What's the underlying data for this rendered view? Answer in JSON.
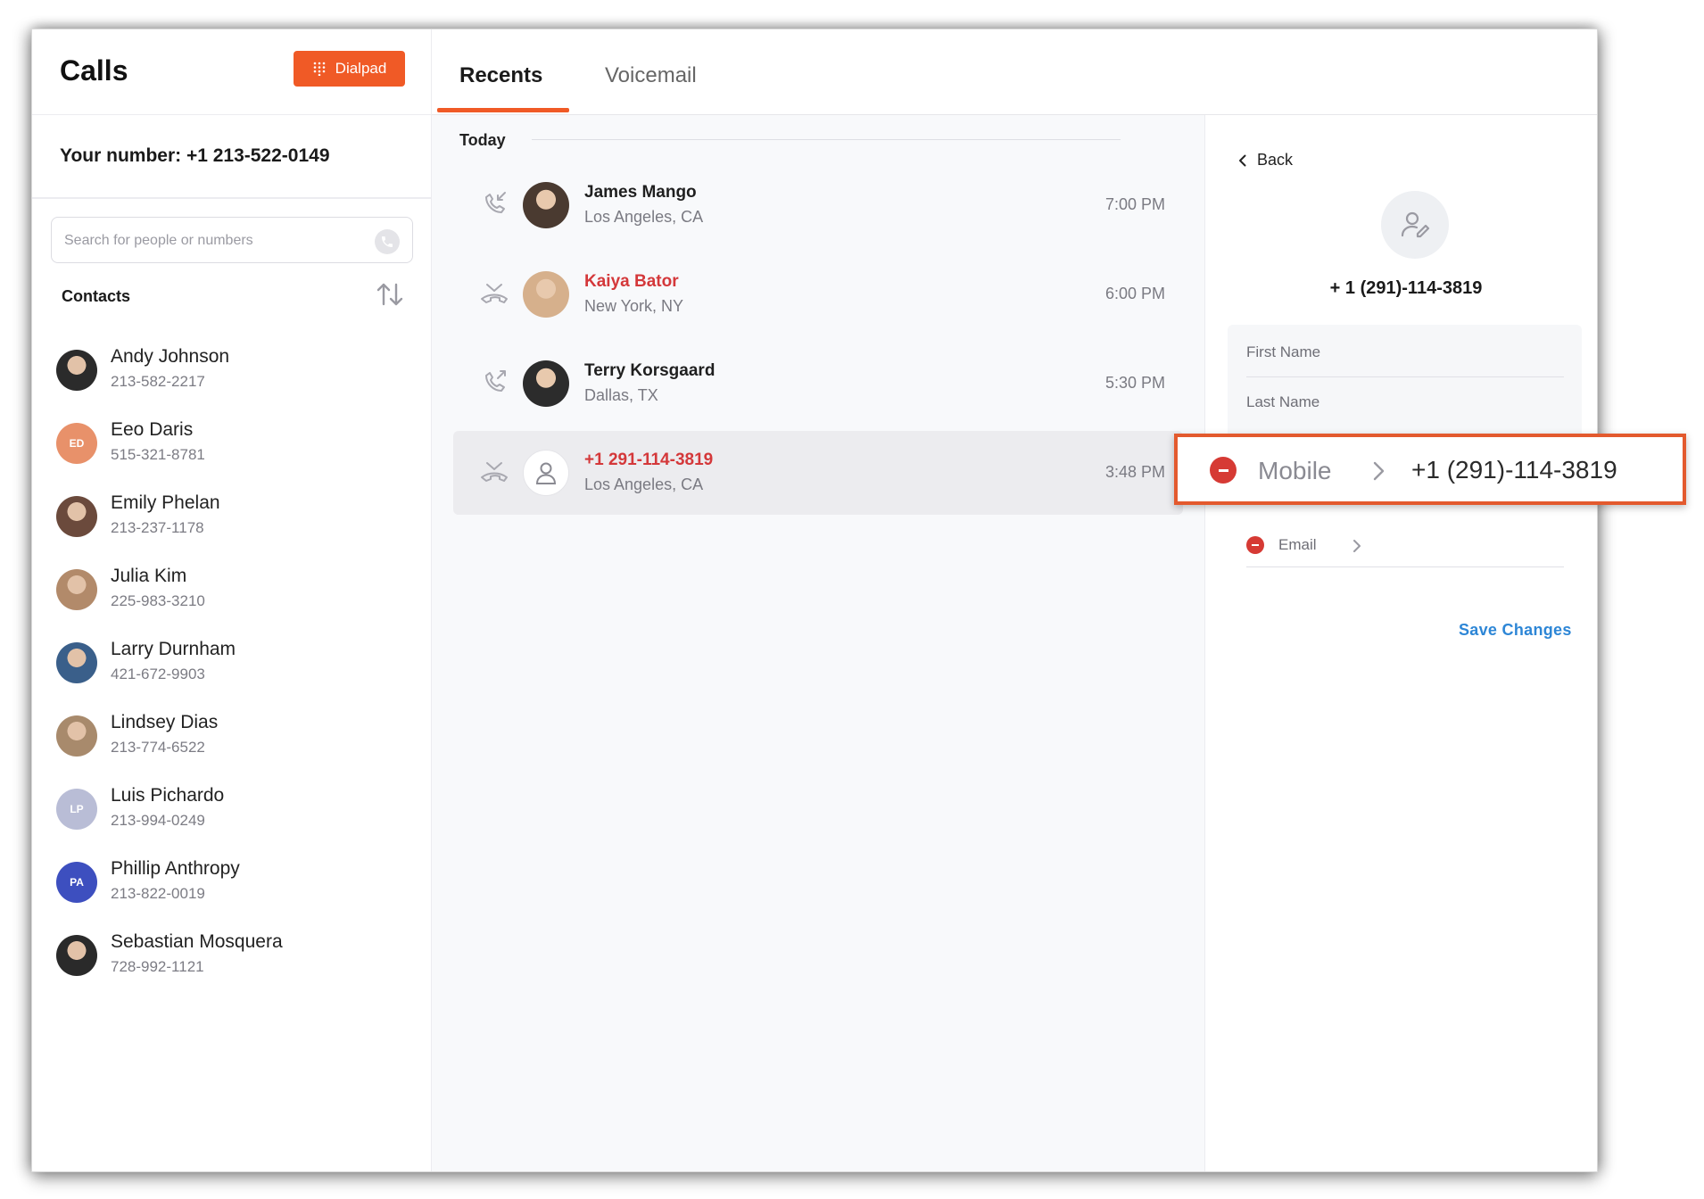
{
  "header": {
    "title": "Calls",
    "dialpad_label": "Dialpad"
  },
  "your_number": "Your number: +1 213-522-0149",
  "search": {
    "placeholder": "Search for people or numbers"
  },
  "contacts": {
    "title": "Contacts",
    "items": [
      {
        "name": "Andy Johnson",
        "phone": "213-582-2217",
        "initials": "",
        "color": "#2b2b2b"
      },
      {
        "name": "Eeo Daris",
        "phone": "515-321-8781",
        "initials": "ED",
        "color": "#e8916a"
      },
      {
        "name": "Emily Phelan",
        "phone": "213-237-1178",
        "initials": "",
        "color": "#6b4a3c"
      },
      {
        "name": "Julia Kim",
        "phone": "225-983-3210",
        "initials": "",
        "color": "#b28a6a"
      },
      {
        "name": "Larry Durnham",
        "phone": "421-672-9903",
        "initials": "",
        "color": "#3a5f8a"
      },
      {
        "name": "Lindsey Dias",
        "phone": "213-774-6522",
        "initials": "",
        "color": "#a88a6c"
      },
      {
        "name": "Luis Pichardo",
        "phone": "213-994-0249",
        "initials": "LP",
        "color": "#b9bdd6"
      },
      {
        "name": "Phillip Anthropy",
        "phone": "213-822-0019",
        "initials": "PA",
        "color": "#3d4fbf"
      },
      {
        "name": "Sebastian Mosquera",
        "phone": "728-992-1121",
        "initials": "",
        "color": "#2a2a2a"
      }
    ]
  },
  "tabs": {
    "recents": "Recents",
    "voicemail": "Voicemail"
  },
  "recents": {
    "section": "Today",
    "calls": [
      {
        "name": "James Mango",
        "location": "Los Angeles, CA",
        "time": "7:00 PM",
        "type": "incoming",
        "missed": false
      },
      {
        "name": "Kaiya Bator",
        "location": "New York, NY",
        "time": "6:00 PM",
        "type": "missed",
        "missed": true
      },
      {
        "name": "Terry Korsgaard",
        "location": "Dallas, TX",
        "time": "5:30 PM",
        "type": "outgoing",
        "missed": false
      },
      {
        "name": "+1 291-114-3819",
        "location": "Los Angeles, CA",
        "time": "3:48 PM",
        "type": "missed",
        "missed": true
      }
    ]
  },
  "detail": {
    "back_label": "Back",
    "phone": "+ 1 (291)-114-3819",
    "first_name_placeholder": "First Name",
    "last_name_placeholder": "Last Name",
    "email_label": "Email",
    "save_label": "Save Changes"
  },
  "callout": {
    "label": "Mobile",
    "value": "+1 (291)-114-3819"
  },
  "colors": {
    "accent": "#f05a26",
    "missed": "#d4383a",
    "link": "#2d86d6",
    "remove": "#d63a34"
  }
}
